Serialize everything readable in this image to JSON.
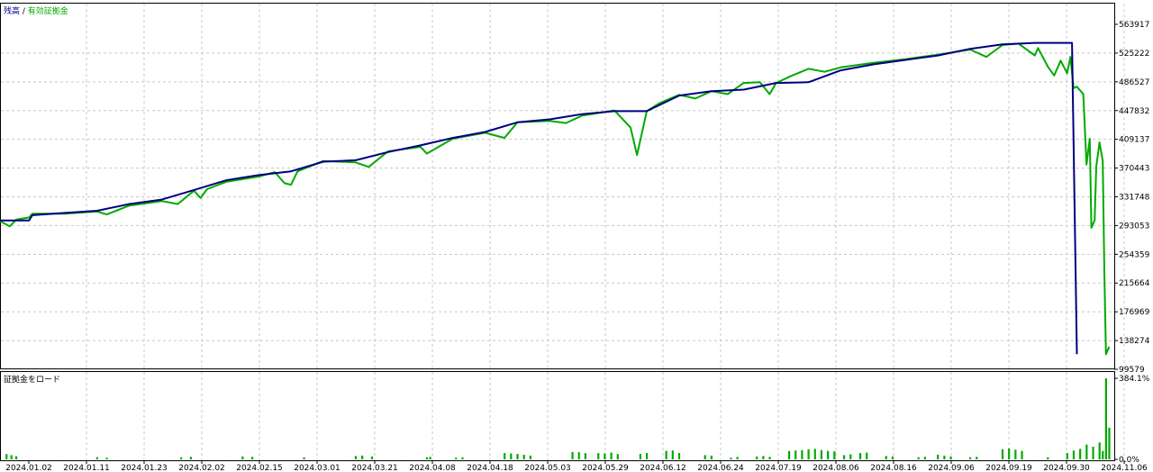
{
  "chart_data": [
    {
      "type": "line",
      "legend": {
        "balance_label": "残高",
        "separator": " / ",
        "equity_label": "有効証拠金",
        "placement": "top-left"
      },
      "colors": {
        "balance": "#000080",
        "equity": "#00aa00",
        "grid": "#c8c8c8"
      },
      "grid": true,
      "y_ticks": [
        "563917",
        "525222",
        "486527",
        "447832",
        "409137",
        "370443",
        "331748",
        "293053",
        "254359",
        "215664",
        "176969",
        "138274",
        "99579"
      ],
      "ylim": [
        99579,
        563917
      ],
      "x_ticks": [
        "2024.01.02",
        "2024.01.11",
        "2024.01.23",
        "2024.02.02",
        "2024.02.15",
        "2024.03.01",
        "2024.03.21",
        "2024.04.08",
        "2024.04.18",
        "2024.05.03",
        "2024.05.29",
        "2024.06.12",
        "2024.06.24",
        "2024.07.19",
        "2024.08.06",
        "2024.08.16",
        "2024.09.06",
        "2024.09.19",
        "2024.09.30",
        "2024.11.06"
      ],
      "series": [
        {
          "name": "残高",
          "points": [
            [
              0,
              300000
            ],
            [
              0.9,
              300000
            ],
            [
              1,
              307000
            ],
            [
              2,
              310000
            ],
            [
              3,
              313000
            ],
            [
              4,
              322000
            ],
            [
              5,
              328000
            ],
            [
              6,
              341000
            ],
            [
              7,
              354000
            ],
            [
              8,
              361000
            ],
            [
              9,
              366000
            ],
            [
              10,
              379000
            ],
            [
              11,
              381000
            ],
            [
              12,
              392000
            ],
            [
              13,
              401000
            ],
            [
              14,
              411000
            ],
            [
              15,
              419000
            ],
            [
              16,
              432000
            ],
            [
              17,
              436000
            ],
            [
              18,
              443000
            ],
            [
              19,
              447000
            ],
            [
              20,
              447000
            ],
            [
              21,
              468000
            ],
            [
              22,
              474000
            ],
            [
              23,
              476000
            ],
            [
              24,
              485000
            ],
            [
              25,
              486000
            ],
            [
              26,
              502000
            ],
            [
              27,
              510000
            ],
            [
              28,
              516000
            ],
            [
              29,
              522000
            ],
            [
              30,
              531000
            ],
            [
              31,
              537000
            ],
            [
              32,
              539000
            ],
            [
              33,
              539000
            ],
            [
              33.15,
              539000
            ],
            [
              33.3,
              120000
            ]
          ]
        },
        {
          "name": "有効証拠金",
          "points": [
            [
              0,
              299000
            ],
            [
              0.3,
              292000
            ],
            [
              0.5,
              301000
            ],
            [
              0.9,
              304000
            ],
            [
              1,
              309000
            ],
            [
              2,
              309000
            ],
            [
              3,
              312000
            ],
            [
              3.3,
              308000
            ],
            [
              4,
              320000
            ],
            [
              5,
              326000
            ],
            [
              5.5,
              322000
            ],
            [
              6,
              340000
            ],
            [
              6.2,
              330000
            ],
            [
              6.4,
              342000
            ],
            [
              7,
              352000
            ],
            [
              8,
              359000
            ],
            [
              8.5,
              365000
            ],
            [
              8.8,
              350000
            ],
            [
              9,
              348000
            ],
            [
              9.2,
              366000
            ],
            [
              10,
              380000
            ],
            [
              11,
              378000
            ],
            [
              11.4,
              372000
            ],
            [
              12,
              393000
            ],
            [
              13,
              399000
            ],
            [
              13.2,
              390000
            ],
            [
              14,
              410000
            ],
            [
              15,
              418000
            ],
            [
              15.6,
              411000
            ],
            [
              16,
              432000
            ],
            [
              17,
              434000
            ],
            [
              17.5,
              431000
            ],
            [
              18,
              441000
            ],
            [
              19,
              448000
            ],
            [
              19.5,
              425000
            ],
            [
              19.7,
              388000
            ],
            [
              20,
              447000
            ],
            [
              20.4,
              458000
            ],
            [
              21,
              469000
            ],
            [
              21.5,
              464000
            ],
            [
              22,
              474000
            ],
            [
              22.5,
              470000
            ],
            [
              23,
              485000
            ],
            [
              23.5,
              486000
            ],
            [
              23.8,
              470000
            ],
            [
              24,
              485000
            ],
            [
              24.5,
              495000
            ],
            [
              25,
              504000
            ],
            [
              25.5,
              500000
            ],
            [
              26,
              506000
            ],
            [
              27,
              512000
            ],
            [
              28,
              517000
            ],
            [
              29,
              523000
            ],
            [
              30,
              530000
            ],
            [
              30.5,
              520000
            ],
            [
              31,
              536000
            ],
            [
              31.5,
              538000
            ],
            [
              32,
              522000
            ],
            [
              32.1,
              532000
            ],
            [
              32.4,
              507000
            ],
            [
              32.6,
              495000
            ],
            [
              32.8,
              515000
            ],
            [
              33,
              498000
            ],
            [
              33.1,
              520000
            ],
            [
              33.2,
              478000
            ],
            [
              33.3,
              480000
            ],
            [
              33.5,
              470000
            ],
            [
              33.6,
              375000
            ],
            [
              33.7,
              410000
            ],
            [
              33.75,
              290000
            ],
            [
              33.85,
              300000
            ],
            [
              33.9,
              372000
            ],
            [
              34,
              405000
            ],
            [
              34.1,
              380000
            ],
            [
              34.15,
              230000
            ],
            [
              34.2,
              120000
            ],
            [
              34.3,
              130000
            ]
          ]
        }
      ],
      "x_range": [
        0,
        34.5
      ]
    },
    {
      "type": "bar",
      "title": "証拠金をロード",
      "y_ticks": [
        "384.1%",
        "0.0%"
      ],
      "ylim": [
        0,
        384.1
      ],
      "color": "#00aa00",
      "bars": [
        [
          0.2,
          25
        ],
        [
          0.35,
          20
        ],
        [
          0.5,
          15
        ],
        [
          3,
          10
        ],
        [
          3.3,
          8
        ],
        [
          5.6,
          10
        ],
        [
          5.9,
          12
        ],
        [
          7.5,
          14
        ],
        [
          7.8,
          12
        ],
        [
          9.4,
          10
        ],
        [
          11,
          16
        ],
        [
          11.2,
          18
        ],
        [
          11.5,
          14
        ],
        [
          13.2,
          10
        ],
        [
          13.3,
          12
        ],
        [
          14.1,
          8
        ],
        [
          14.3,
          10
        ],
        [
          15.6,
          30
        ],
        [
          15.8,
          28
        ],
        [
          16.0,
          26
        ],
        [
          16.2,
          22
        ],
        [
          16.4,
          18
        ],
        [
          17.7,
          35
        ],
        [
          17.9,
          34
        ],
        [
          18.1,
          30
        ],
        [
          18.5,
          30
        ],
        [
          18.7,
          28
        ],
        [
          18.9,
          32
        ],
        [
          19.1,
          25
        ],
        [
          19.8,
          26
        ],
        [
          20.0,
          30
        ],
        [
          20.6,
          40
        ],
        [
          20.8,
          42
        ],
        [
          21.0,
          30
        ],
        [
          21.8,
          20
        ],
        [
          22.0,
          18
        ],
        [
          22.6,
          8
        ],
        [
          22.8,
          12
        ],
        [
          23.4,
          14
        ],
        [
          23.6,
          16
        ],
        [
          23.8,
          12
        ],
        [
          24.4,
          40
        ],
        [
          24.6,
          42
        ],
        [
          24.8,
          44
        ],
        [
          25.0,
          48
        ],
        [
          25.2,
          50
        ],
        [
          25.4,
          44
        ],
        [
          25.6,
          40
        ],
        [
          25.8,
          38
        ],
        [
          26.1,
          20
        ],
        [
          26.3,
          24
        ],
        [
          26.6,
          30
        ],
        [
          26.8,
          32
        ],
        [
          27.4,
          16
        ],
        [
          27.6,
          14
        ],
        [
          28.4,
          10
        ],
        [
          28.6,
          12
        ],
        [
          29.0,
          22
        ],
        [
          29.2,
          18
        ],
        [
          29.4,
          14
        ],
        [
          30.0,
          10
        ],
        [
          30.2,
          12
        ],
        [
          31.0,
          48
        ],
        [
          31.2,
          52
        ],
        [
          31.4,
          46
        ],
        [
          31.6,
          40
        ],
        [
          32.4,
          10
        ],
        [
          33.0,
          30
        ],
        [
          33.2,
          42
        ],
        [
          33.4,
          50
        ],
        [
          33.6,
          70
        ],
        [
          33.8,
          60
        ],
        [
          34.0,
          80
        ],
        [
          34.1,
          40
        ],
        [
          34.2,
          384.1
        ],
        [
          34.3,
          150
        ]
      ]
    }
  ]
}
